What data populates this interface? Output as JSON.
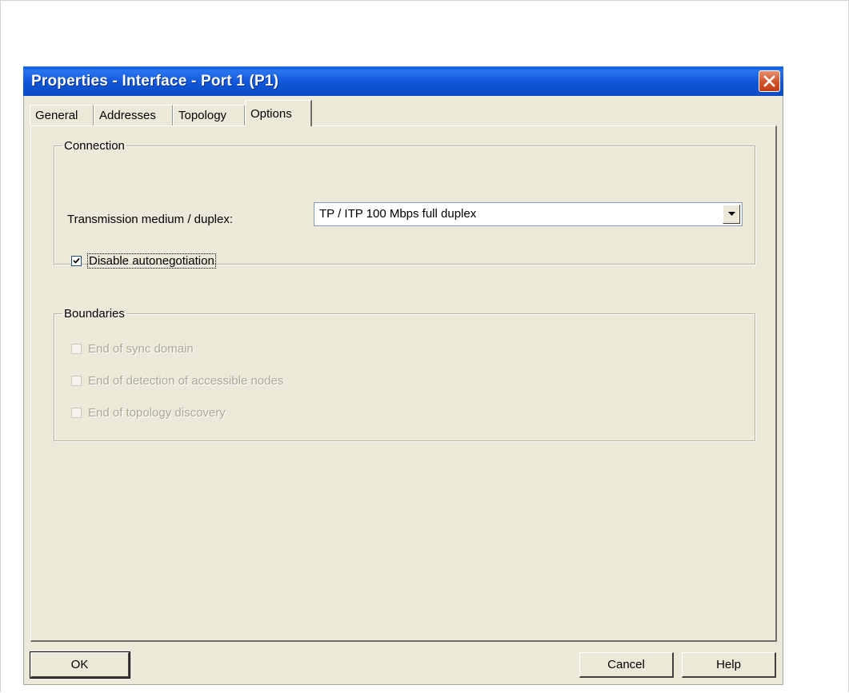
{
  "window": {
    "title": "Properties - Interface - Port 1 (P1)",
    "close_icon": "close-icon"
  },
  "tabs": [
    {
      "label": "General",
      "active": false
    },
    {
      "label": "Addresses",
      "active": false
    },
    {
      "label": "Topology",
      "active": false
    },
    {
      "label": "Options",
      "active": true
    }
  ],
  "connection": {
    "group_label": "Connection",
    "medium_label": "Transmission medium / duplex:",
    "medium_value": "TP / ITP 100 Mbps full duplex",
    "disable_autoneg_label": "Disable autonegotiation",
    "disable_autoneg_checked": true
  },
  "boundaries": {
    "group_label": "Boundaries",
    "items": [
      {
        "label": "End of sync domain",
        "checked": false,
        "enabled": false
      },
      {
        "label": "End of detection of accessible nodes",
        "checked": false,
        "enabled": false
      },
      {
        "label": "End of topology discovery",
        "checked": false,
        "enabled": false
      }
    ]
  },
  "buttons": {
    "ok": "OK",
    "cancel": "Cancel",
    "help": "Help"
  },
  "colors": {
    "titlebar": "#0a56d8",
    "dialog_bg": "#ece9d8",
    "close_button": "#d2542c"
  }
}
